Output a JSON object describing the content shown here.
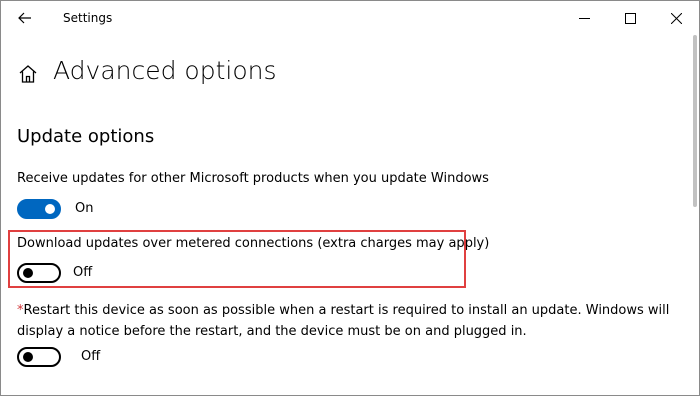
{
  "window": {
    "title": "Settings"
  },
  "header": {
    "page_title": "Advanced options",
    "home_icon": "home-icon",
    "back_icon": "back-arrow-icon"
  },
  "section": {
    "title": "Update options"
  },
  "settings": [
    {
      "label": "Receive updates for other Microsoft products when you update Windows",
      "state": "On"
    },
    {
      "label": "Download updates over metered connections (extra charges may apply)",
      "state": "Off"
    },
    {
      "asterisk": "*",
      "label": "Restart this device as soon as possible when a restart is required to install an update. Windows will display a notice before the restart, and the device must be on and plugged in.",
      "state": "Off"
    }
  ],
  "colors": {
    "accent": "#0067c0",
    "highlight": "#e04040",
    "asterisk": "#d13438"
  }
}
